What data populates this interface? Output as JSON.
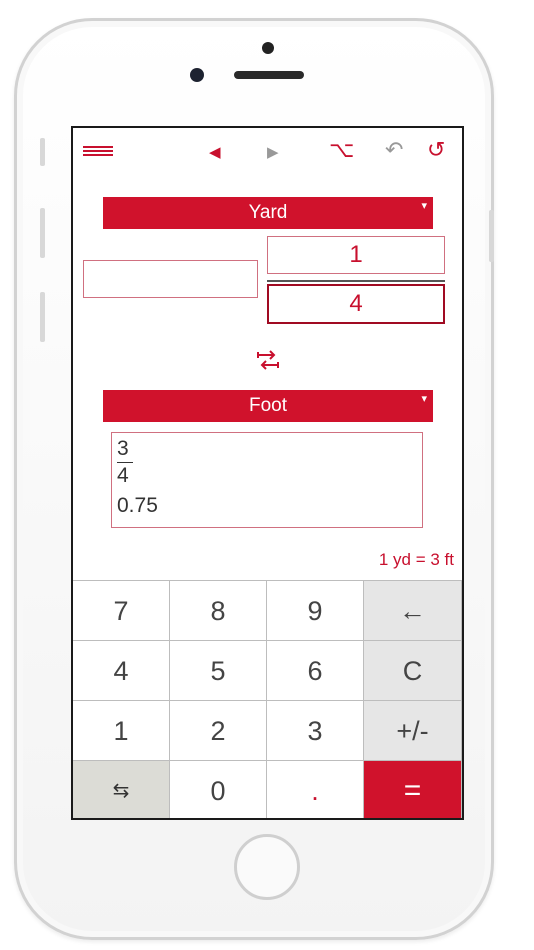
{
  "toolbar": {
    "menu_icon": "hamburger-icon",
    "back_icon": "◀",
    "forward_icon": "▶",
    "option_icon": "⌥",
    "undo_icon": "↶",
    "reset_icon": "↺"
  },
  "from_unit": {
    "label": "Yard",
    "caret": "▾",
    "whole_value": "",
    "numerator": "1",
    "denominator": "4"
  },
  "swap_icon": "⇆",
  "to_unit": {
    "label": "Foot",
    "caret": "▾",
    "result_numerator": "3",
    "result_denominator": "4",
    "result_decimal": "0.75"
  },
  "relation_text": "1 yd = 3 ft",
  "keypad": {
    "rows": [
      [
        "7",
        "8",
        "9",
        "←"
      ],
      [
        "4",
        "5",
        "6",
        "C"
      ],
      [
        "1",
        "2",
        "3",
        "+/-"
      ],
      [
        "⇆",
        "0",
        ".",
        "="
      ]
    ]
  },
  "colors": {
    "accent": "#d0122c",
    "key_bg": "#ffffff",
    "op_key_bg": "#e6e6e6"
  }
}
